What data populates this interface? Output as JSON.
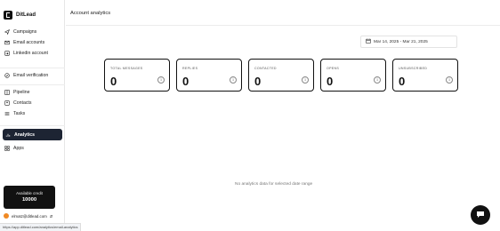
{
  "brand": {
    "name": "DitLead"
  },
  "nav": {
    "group1": [
      {
        "label": "Campaigns",
        "icon": "send-icon"
      },
      {
        "label": "Email accounts",
        "icon": "mail-icon"
      },
      {
        "label": "Linkedin account",
        "icon": "linkedin-icon"
      }
    ],
    "group2": [
      {
        "label": "Email verification",
        "icon": "verify-icon"
      }
    ],
    "group3": [
      {
        "label": "Pipeline",
        "icon": "pipeline-icon"
      },
      {
        "label": "Contacts",
        "icon": "contacts-icon"
      },
      {
        "label": "Tasks",
        "icon": "tasks-icon"
      }
    ],
    "group4": [
      {
        "label": "Analytics",
        "icon": "analytics-icon",
        "active": true
      },
      {
        "label": "Apps",
        "icon": "apps-icon"
      }
    ]
  },
  "credit": {
    "label": "Available credit",
    "value": "10000"
  },
  "user": {
    "email": "elmatz@ditlead.com"
  },
  "status_url": "https://app.ditlead.com/analytics/email-analytics",
  "header": {
    "title": "Account analytics"
  },
  "date_range": {
    "text": "Mar 14, 2025 - Mar 21, 2025"
  },
  "stats": [
    {
      "title": "TOTAL MESSAGES",
      "value": "0"
    },
    {
      "title": "REPLIES",
      "value": "0"
    },
    {
      "title": "CONTACTED",
      "value": "0"
    },
    {
      "title": "OPENS",
      "value": "0"
    },
    {
      "title": "UNSUBSCRIBED",
      "value": "0"
    }
  ],
  "empty_state": "No analytics data for selected date range",
  "colors": {
    "active_nav": "#1d2433",
    "accent": "#111111",
    "avatar": "#f08a24"
  }
}
